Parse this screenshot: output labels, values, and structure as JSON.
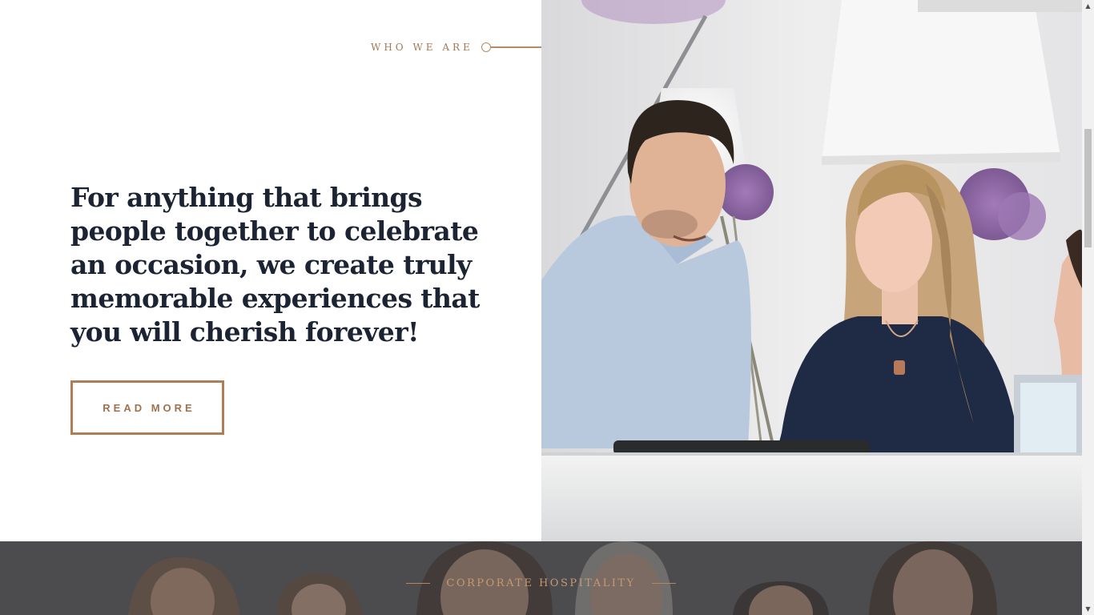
{
  "who_we_are": {
    "eyebrow": "WHO WE ARE",
    "headline": "For anything that brings people together to celebrate an occasion, we create truly memorable experiences that you will cherish forever!",
    "read_more_label": "READ MORE"
  },
  "photo": {
    "icon": "reception-photo"
  },
  "corporate": {
    "heading": "CORPORATE HOSPITALITY"
  },
  "scrollbar": {
    "up_arrow": "▲",
    "down_arrow": "▼"
  },
  "colors": {
    "accent": "#b07d55",
    "headline": "#1c2434",
    "band": "#4a4a4c"
  }
}
